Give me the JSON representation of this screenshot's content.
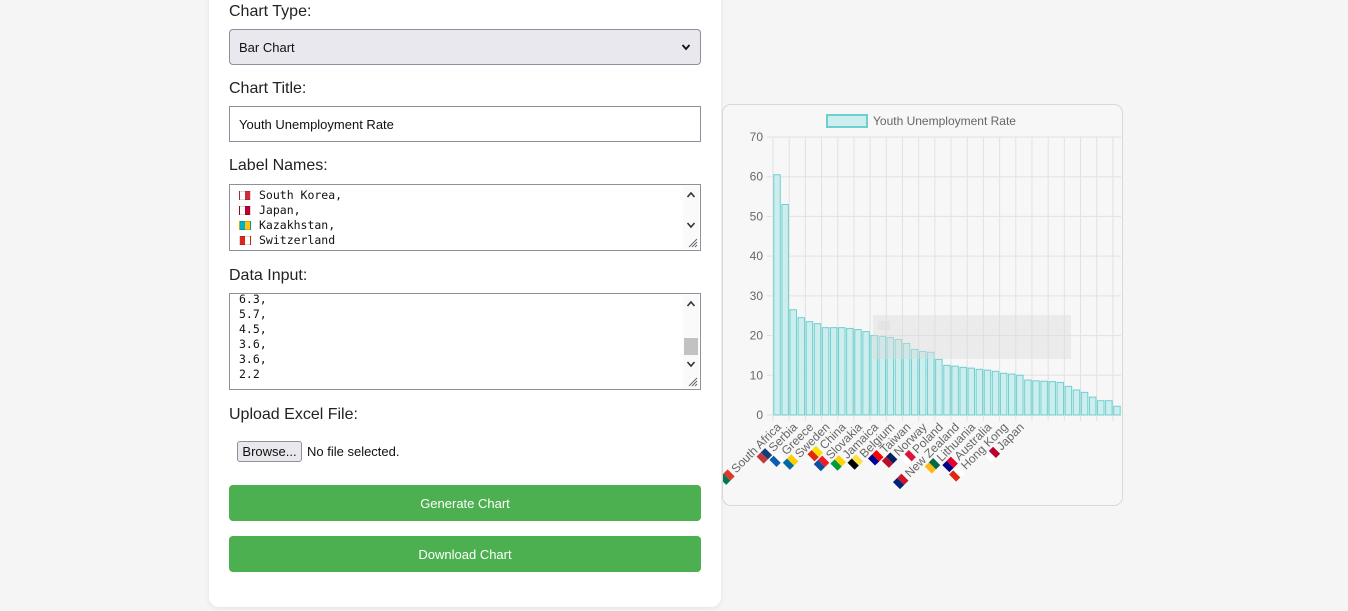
{
  "form": {
    "chart_type_label": "Chart Type:",
    "chart_type_value": "Bar Chart",
    "chart_title_label": "Chart Title:",
    "chart_title_value": "Youth Unemployment Rate",
    "label_names_label": "Label Names:",
    "label_names_lines": [
      {
        "flag_colors": [
          "#ffffff",
          "#cd2e3a"
        ],
        "text": "South Korea,"
      },
      {
        "flag_colors": [
          "#ffffff",
          "#bc002d"
        ],
        "text": "Japan,"
      },
      {
        "flag_colors": [
          "#00afca",
          "#fec50c"
        ],
        "text": "Kazakhstan,"
      },
      {
        "flag_colors": [
          "#da291c",
          "#ffffff"
        ],
        "text": "Switzerland"
      }
    ],
    "data_input_label": "Data Input:",
    "data_input_lines": [
      "6.3,",
      "5.7,",
      "4.5,",
      "3.6,",
      "3.6,",
      "2.2"
    ],
    "upload_label": "Upload Excel File:",
    "browse_label": "Browse...",
    "no_file_text": "No file selected.",
    "generate_label": "Generate Chart",
    "download_label": "Download Chart"
  },
  "colors": {
    "accent": "#4caf50",
    "bar_fill": "#cdeeee",
    "bar_stroke": "#6fcfcf"
  },
  "chart_data": {
    "type": "bar",
    "title": "",
    "legend": "Youth Unemployment Rate",
    "legend_position": "top",
    "xlabel": "",
    "ylabel": "",
    "ylim": [
      0,
      70
    ],
    "yticks": [
      0,
      10,
      20,
      30,
      40,
      50,
      60,
      70
    ],
    "grid": true,
    "values": [
      60.5,
      53,
      26.5,
      24.5,
      23.5,
      23,
      22,
      22,
      22,
      21.8,
      21.5,
      21,
      20,
      19.8,
      19.5,
      19,
      18,
      16.5,
      16,
      15.8,
      14,
      12.5,
      12.3,
      12,
      11.8,
      11.5,
      11.3,
      11,
      10.5,
      10.3,
      10,
      8.8,
      8.6,
      8.5,
      8.4,
      8.2,
      7.2,
      6.3,
      5.7,
      4.5,
      3.6,
      3.6,
      2.2
    ],
    "tick_labels": [
      {
        "index": 0,
        "label": "South Africa",
        "flag_colors": [
          "#007a4d",
          "#de3831"
        ]
      },
      {
        "index": 2,
        "label": "Serbia",
        "flag_colors": [
          "#c6363c",
          "#0c4076"
        ]
      },
      {
        "index": 4,
        "label": "Greece",
        "flag_colors": [
          "#0d5eaf",
          "#ffffff"
        ]
      },
      {
        "index": 6,
        "label": "Sweden",
        "flag_colors": [
          "#006aa7",
          "#fecc00"
        ]
      },
      {
        "index": 8,
        "label": "China",
        "flag_colors": [
          "#de2910",
          "#ffde00"
        ]
      },
      {
        "index": 10,
        "label": "Slovakia",
        "flag_colors": [
          "#0b4ea2",
          "#ee1c25"
        ]
      },
      {
        "index": 12,
        "label": "Jamaica",
        "flag_colors": [
          "#009b3a",
          "#fed100"
        ]
      },
      {
        "index": 14,
        "label": "Belgium",
        "flag_colors": [
          "#000000",
          "#fae042"
        ]
      },
      {
        "index": 16,
        "label": "Taiwan",
        "flag_colors": [
          "#000095",
          "#fe0000"
        ]
      },
      {
        "index": 18,
        "label": "Norway",
        "flag_colors": [
          "#ba0c2f",
          "#00205b"
        ]
      },
      {
        "index": 20,
        "label": "Poland",
        "flag_colors": [
          "#ffffff",
          "#dc143c"
        ]
      },
      {
        "index": 22,
        "label": "New Zealand",
        "flag_colors": [
          "#00247d",
          "#cc142b"
        ]
      },
      {
        "index": 24,
        "label": "Lithuania",
        "flag_colors": [
          "#fdb913",
          "#006a44"
        ]
      },
      {
        "index": 26,
        "label": "Australia",
        "flag_colors": [
          "#00008b",
          "#e4002b"
        ]
      },
      {
        "index": 28,
        "label": "Hong Kong",
        "flag_colors": [
          "#de2910",
          "#ffffff"
        ]
      },
      {
        "index": 30,
        "label": "Japan",
        "flag_colors": [
          "#ffffff",
          "#bc002d"
        ]
      }
    ]
  }
}
